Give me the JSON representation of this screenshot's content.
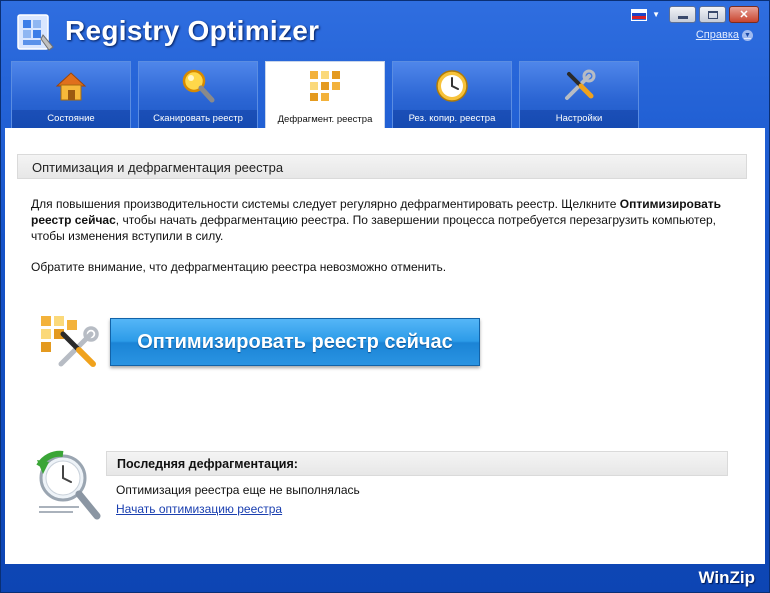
{
  "app": {
    "title": "Registry Optimizer",
    "brand": "WinZip",
    "help_label": "Справка"
  },
  "tabs": [
    {
      "label": "Состояние",
      "icon": "home-icon",
      "active": false
    },
    {
      "label": "Сканировать реестр",
      "icon": "magnifier-icon",
      "active": false
    },
    {
      "label": "Дефрагмент. реестра",
      "icon": "defrag-blocks-icon",
      "active": true
    },
    {
      "label": "Рез. копир. реестра",
      "icon": "clock-backup-icon",
      "active": false
    },
    {
      "label": "Настройки",
      "icon": "tools-icon",
      "active": false
    }
  ],
  "main": {
    "section_title": "Оптимизация и дефрагментация реестра",
    "intro_part1": "Для повышения производительности системы следует регулярно дефрагментировать реестр. Щелкните ",
    "intro_bold": "Оптимизировать реестр сейчас",
    "intro_part2": ", чтобы начать дефрагментацию реестра. По завершении процесса потребуется перезагрузить компьютер, чтобы изменения вступили в силу.",
    "note": "Обратите внимание, что дефрагментацию реестра невозможно отменить.",
    "optimize_button": "Оптимизировать реестр сейчас"
  },
  "last_defrag": {
    "title": "Последняя дефрагментация:",
    "status": "Оптимизация реестра еще не выполнялась",
    "link": "Начать оптимизацию реестра"
  },
  "colors": {
    "frame": "#1553c9",
    "tab": "#2c66d4",
    "button": "#2c9be8",
    "link": "#1a3fb0"
  }
}
